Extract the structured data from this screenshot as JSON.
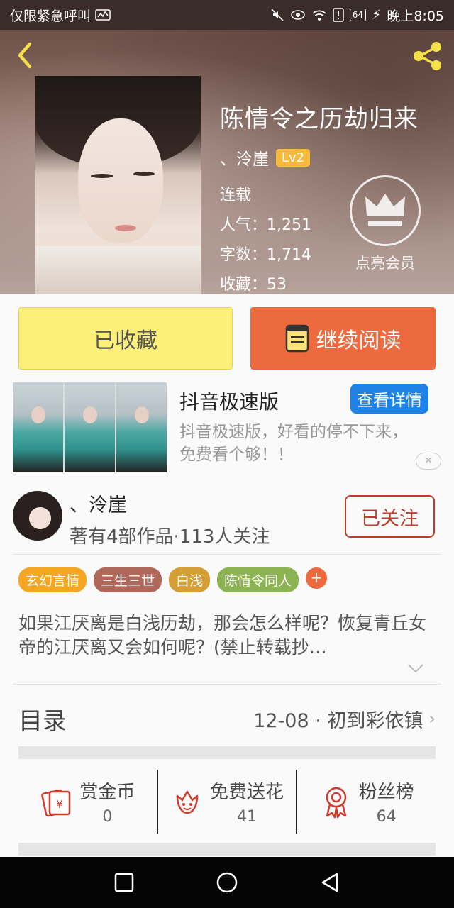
{
  "status_bar": {
    "carrier": "仅限紧急呼叫",
    "battery": "64",
    "time": "晚上8:05"
  },
  "book": {
    "title": "陈情令之历劫归来",
    "author": "、泠崖",
    "level": "Lv2",
    "status": "连载",
    "popularity_label": "人气：1,251",
    "words_label": "字数：1,714",
    "favorites_label": "收藏：53",
    "vip_label": "点亮会员"
  },
  "actions": {
    "collected": "已收藏",
    "continue_reading": "继续阅读"
  },
  "ad": {
    "title": "抖音极速版",
    "detail_button": "查看详情",
    "description": "抖音极速版，好看的停不下来，免费看个够！！"
  },
  "author_card": {
    "name": "、泠崖",
    "meta": "著有4部作品·113人关注",
    "follow_button": "已关注"
  },
  "tags": [
    {
      "label": "玄幻言情",
      "color": "#f5a623"
    },
    {
      "label": "三生三世",
      "color": "#b0685a"
    },
    {
      "label": "白浅",
      "color": "#d4a035"
    },
    {
      "label": "陈情令同人",
      "color": "#8bb352"
    }
  ],
  "tag_add": "+",
  "synopsis": "如果江厌离是白浅历劫，那会怎么样呢？恢复青丘女帝的江厌离又会如何呢？(禁止转载抄…",
  "toc": {
    "label": "目录",
    "latest": "12-08 · 初到彩依镇"
  },
  "stats": [
    {
      "label": "赏金币",
      "value": "0",
      "icon": "red-envelope-icon"
    },
    {
      "label": "免费送花",
      "value": "41",
      "icon": "flower-icon"
    },
    {
      "label": "粉丝榜",
      "value": "64",
      "icon": "medal-icon"
    }
  ],
  "colors": {
    "accent_orange": "#ec6a3d",
    "collected_yellow": "#fdf07a",
    "follow_red": "#c0392b",
    "ad_blue": "#1e82e6"
  }
}
